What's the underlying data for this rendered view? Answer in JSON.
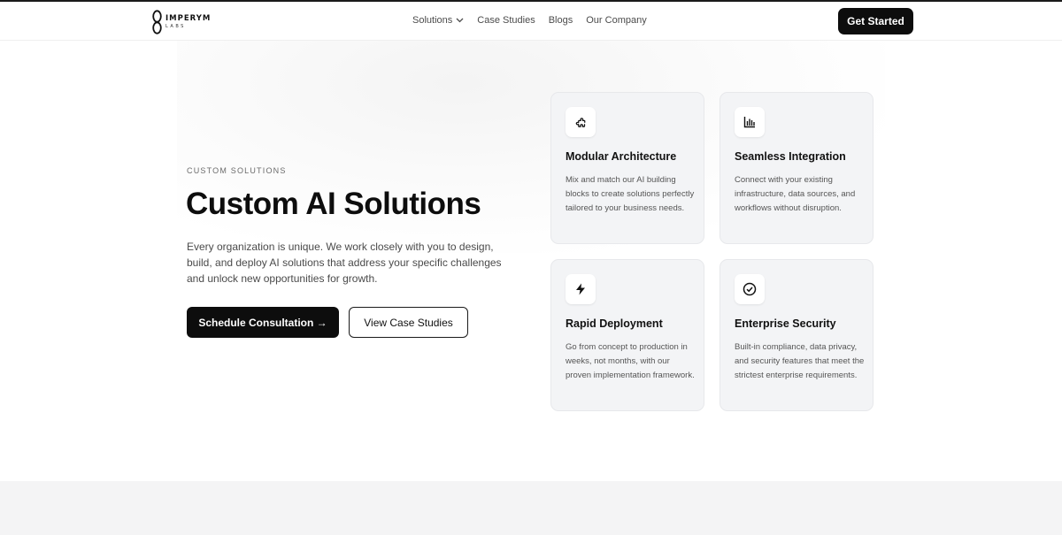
{
  "brand": {
    "name": "IMPERYM",
    "sub": "LABS"
  },
  "nav": {
    "items": [
      {
        "label": "Solutions",
        "has_dropdown": true
      },
      {
        "label": "Case Studies"
      },
      {
        "label": "Blogs"
      },
      {
        "label": "Our Company"
      }
    ],
    "cta_label": "Get Started"
  },
  "hero": {
    "eyebrow": "CUSTOM SOLUTIONS",
    "title": "Custom AI Solutions",
    "description": "Every organization is unique. We work closely with you to design, build, and deploy AI solutions that address your specific challenges and unlock new opportunities for growth.",
    "primary_button": "Schedule Consultation →",
    "secondary_button": "View Case Studies"
  },
  "features": [
    {
      "icon": "puzzle-icon",
      "title": "Modular Architecture",
      "description": "Mix and match our AI building blocks to create solutions perfectly tailored to your business needs."
    },
    {
      "icon": "bar-chart-icon",
      "title": "Seamless Integration",
      "description": "Connect with your existing infrastructure, data sources, and workflows without disruption."
    },
    {
      "icon": "lightning-icon",
      "title": "Rapid Deployment",
      "description": "Go from concept to production in weeks, not months, with our proven implementation framework."
    },
    {
      "icon": "check-circle-icon",
      "title": "Enterprise Security",
      "description": "Built-in compliance, data privacy, and security features that meet the strictest enterprise requirements."
    }
  ],
  "colors": {
    "primary": "#0d0d0d",
    "card_bg": "#f3f4f6",
    "text_muted": "#555555",
    "page_bg": "#ffffff"
  }
}
